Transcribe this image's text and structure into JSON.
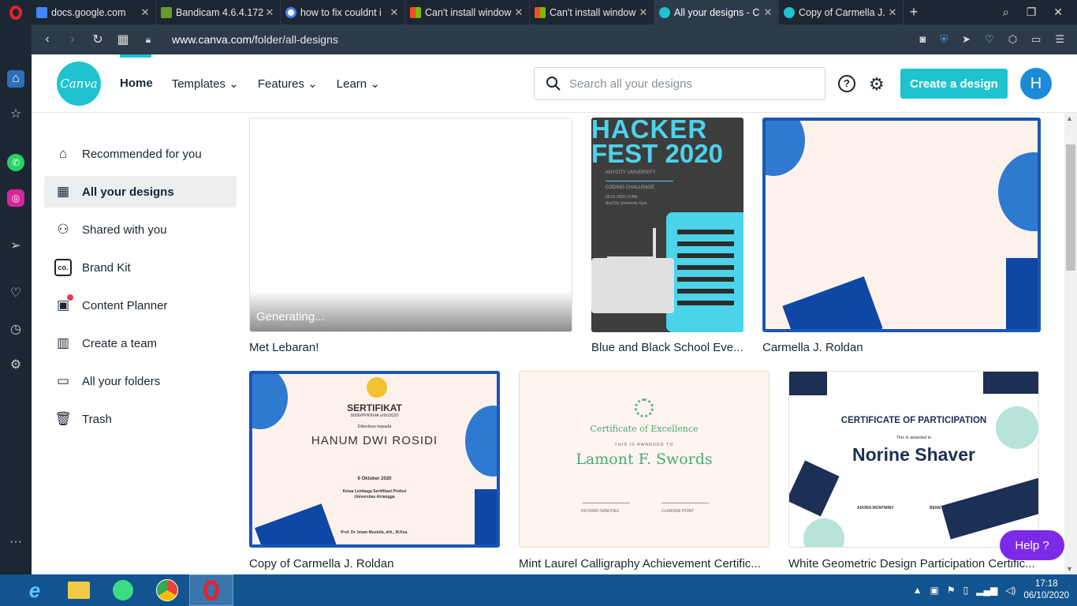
{
  "browser": {
    "tabs": [
      {
        "title": "docs.google.com",
        "color": "#4285f4"
      },
      {
        "title": "Bandicam 4.6.4.172",
        "color": "#6a9a2a"
      },
      {
        "title": "how to fix couldnt i",
        "color": "#ffffff"
      },
      {
        "title": "Can't install window",
        "color": "#f25022"
      },
      {
        "title": "Can't install window",
        "color": "#f25022"
      },
      {
        "title": "All your designs - C",
        "color": "#1fc3d0"
      },
      {
        "title": "Copy of Carmella J.",
        "color": "#1fc3d0"
      }
    ],
    "url_prefix": "www.canva.com",
    "url_path": "/folder/all-designs"
  },
  "canva": {
    "logo": "Canva",
    "nav": {
      "home": "Home",
      "templates": "Templates",
      "features": "Features",
      "learn": "Learn"
    },
    "search_placeholder": "Search all your designs",
    "help_q": "?",
    "create_label": "Create a design",
    "avatar_letter": "H",
    "help_label": "Help ?"
  },
  "sidebar": [
    {
      "label": "Recommended for you",
      "icon": "home-icon"
    },
    {
      "label": "All your designs",
      "icon": "grid-icon",
      "active": true
    },
    {
      "label": "Shared with you",
      "icon": "people-icon"
    },
    {
      "label": "Brand Kit",
      "icon": "brand-icon"
    },
    {
      "label": "Content Planner",
      "icon": "calendar-icon"
    },
    {
      "label": "Create a team",
      "icon": "building-icon"
    },
    {
      "label": "All your folders",
      "icon": "folder-icon"
    },
    {
      "label": "Trash",
      "icon": "trash-icon"
    }
  ],
  "designs": [
    {
      "title": "Met Lebaran!",
      "status": "Generating..."
    },
    {
      "title": "Blue and Black School Eve...",
      "line1": "HACKER",
      "line2": "FEST 2020",
      "org": "ANYCITY UNIVERSITY",
      "event": "CODING CHALLENGE",
      "date": "06.01.2020 | 9 AM",
      "place": "AnyCity University Gym"
    },
    {
      "title": "Carmella J. Roldan"
    },
    {
      "title": "Copy of Carmella J. Roldan",
      "heading": "SERTIFIKAT",
      "number": "0006/PPKKHA.s/IX/2020",
      "given": "Diberikan kepada",
      "name": "HANUM DWI ROSIDI",
      "date": "6 Oktober 2020",
      "org": "Ketua Lembaga Sertifikasi Profesi",
      "org2": "Universitas Airlangga",
      "signer": "Prof. Dr. Imam Mustofa, drh., M.Kes."
    },
    {
      "title": "Mint Laurel Calligraphy Achievement Certific...",
      "heading": "Certificate of Excellence",
      "awarded": "THIS IS AWARDED TO",
      "name": "Lamont F. Swords",
      "sig1": "RICHARD SANCHEZ",
      "sig2": "CLARISSE POINT"
    },
    {
      "title": "White Geometric Design Participation Certific...",
      "heading": "CERTIFICATE OF PARTICIPATION",
      "awarded": "This is awarded to",
      "name": "Norine Shaver",
      "sig1": "ADORA MONTMINY",
      "sig2": "BENN"
    }
  ],
  "taskbar": {
    "time": "17:18",
    "date": "06/10/2020"
  }
}
